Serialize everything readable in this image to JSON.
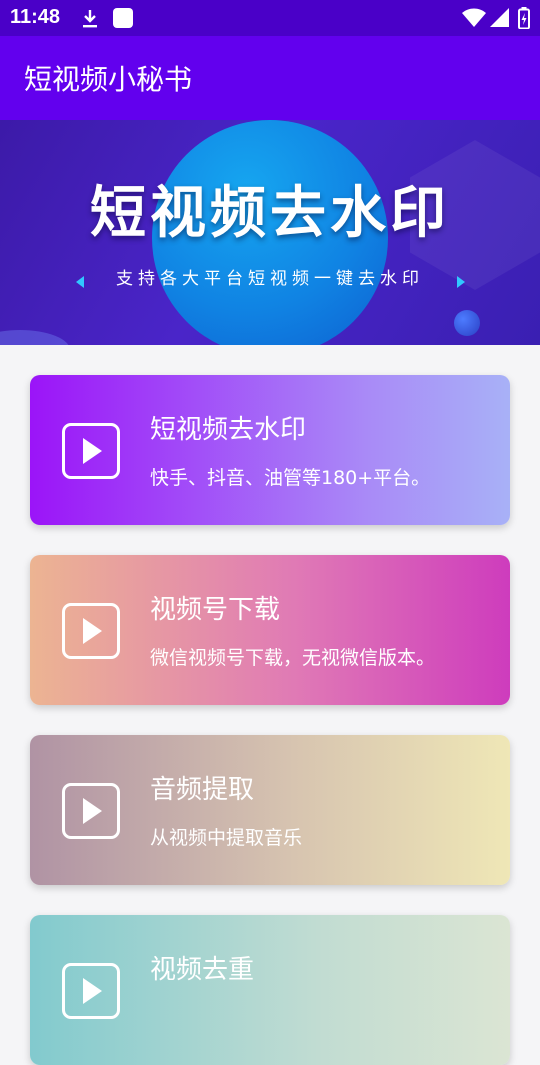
{
  "status_bar": {
    "time": "11:48",
    "icons": [
      "download-icon",
      "app-notification-icon",
      "wifi-icon",
      "signal-icon",
      "battery-icon"
    ]
  },
  "app_bar": {
    "title": "短视频小秘书"
  },
  "banner": {
    "title": "短视频去水印",
    "subtitle": "支持各大平台短视频一键去水印"
  },
  "cards": [
    {
      "title": "短视频去水印",
      "desc": "快手、抖音、油管等180+平台。",
      "icon": "play-icon"
    },
    {
      "title": "视频号下载",
      "desc": "微信视频号下载，无视微信版本。",
      "icon": "play-icon"
    },
    {
      "title": "音频提取",
      "desc": "从视频中提取音乐",
      "icon": "play-icon"
    },
    {
      "title": "视频去重",
      "desc": "",
      "icon": "play-icon"
    }
  ],
  "colors": {
    "status_bar": "#4a00c8",
    "app_bar": "#6200ee",
    "background": "#f5f5f7"
  }
}
